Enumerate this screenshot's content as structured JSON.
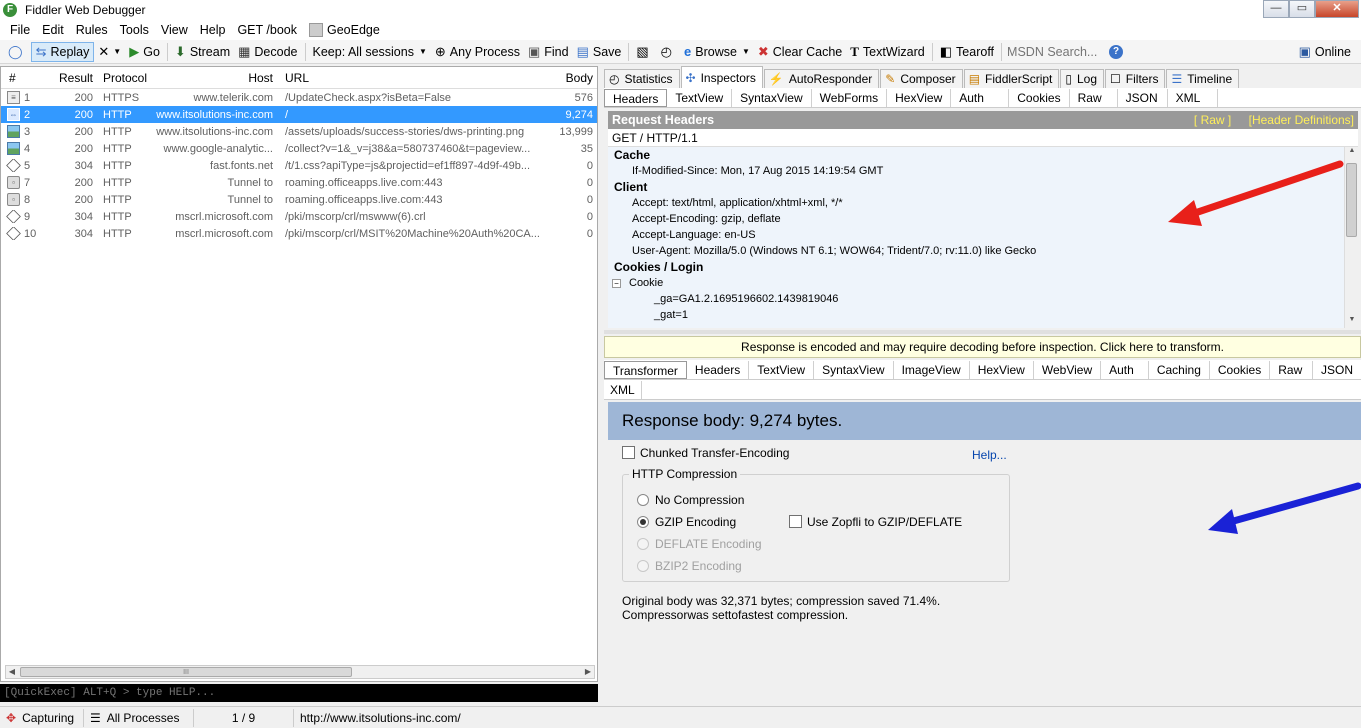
{
  "app": {
    "title": "Fiddler Web Debugger",
    "icon": "fiddler-logo-icon"
  },
  "window_controls": {
    "minimize": "—",
    "maximize": "▭",
    "close": "✕"
  },
  "menu": [
    {
      "label": "File"
    },
    {
      "label": "Edit"
    },
    {
      "label": "Rules"
    },
    {
      "label": "Tools"
    },
    {
      "label": "View"
    },
    {
      "label": "Help"
    },
    {
      "label": "GET /book"
    },
    {
      "label": "GeoEdge"
    }
  ],
  "toolbar": {
    "replay": "Replay",
    "go": "Go",
    "stream": "Stream",
    "decode": "Decode",
    "keep": "Keep: All sessions",
    "any_process": "Any Process",
    "find": "Find",
    "save": "Save",
    "browse": "Browse",
    "clear_cache": "Clear Cache",
    "textwizard": "TextWizard",
    "tearoff": "Tearoff",
    "msdn_placeholder": "MSDN Search...",
    "online": "Online"
  },
  "sessions": {
    "columns": {
      "num": "#",
      "result": "Result",
      "protocol": "Protocol",
      "host": "Host",
      "url": "URL",
      "body": "Body"
    },
    "rows": [
      {
        "num": "1",
        "icon": "document-icon",
        "result": "200",
        "protocol": "HTTPS",
        "host": "www.telerik.com",
        "url": "/UpdateCheck.aspx?isBeta=False",
        "body": "576"
      },
      {
        "num": "2",
        "icon": "arrows-icon",
        "result": "200",
        "protocol": "HTTP",
        "host": "www.itsolutions-inc.com",
        "url": "/",
        "body": "9,274"
      },
      {
        "num": "3",
        "icon": "image-icon",
        "result": "200",
        "protocol": "HTTP",
        "host": "www.itsolutions-inc.com",
        "url": "/assets/uploads/success-stories/dws-printing.png",
        "body": "13,999"
      },
      {
        "num": "4",
        "icon": "image-icon",
        "result": "200",
        "protocol": "HTTP",
        "host": "www.google-analytic...",
        "url": "/collect?v=1&_v=j38&a=580737460&t=pageview...",
        "body": "35"
      },
      {
        "num": "5",
        "icon": "diamond-icon",
        "result": "304",
        "protocol": "HTTP",
        "host": "fast.fonts.net",
        "url": "/t/1.css?apiType=js&projectid=ef1ff897-4d9f-49b...",
        "body": "0"
      },
      {
        "num": "7",
        "icon": "lock-icon",
        "result": "200",
        "protocol": "HTTP",
        "host": "Tunnel to",
        "url": "roaming.officeapps.live.com:443",
        "body": "0"
      },
      {
        "num": "8",
        "icon": "lock-icon",
        "result": "200",
        "protocol": "HTTP",
        "host": "Tunnel to",
        "url": "roaming.officeapps.live.com:443",
        "body": "0"
      },
      {
        "num": "9",
        "icon": "diamond-icon",
        "result": "304",
        "protocol": "HTTP",
        "host": "mscrl.microsoft.com",
        "url": "/pki/mscorp/crl/mswww(6).crl",
        "body": "0"
      },
      {
        "num": "10",
        "icon": "diamond-icon",
        "result": "304",
        "protocol": "HTTP",
        "host": "mscrl.microsoft.com",
        "url": "/pki/mscorp/crl/MSIT%20Machine%20Auth%20CA...",
        "body": "0"
      }
    ],
    "selected_index": 1,
    "scroll_grip": "III"
  },
  "quickexec": {
    "placeholder": "[QuickExec] ALT+Q > type HELP..."
  },
  "statusbar": {
    "capturing": "Capturing",
    "processes": "All Processes",
    "count": "1 / 9",
    "url": "http://www.itsolutions-inc.com/"
  },
  "main_tabs": [
    {
      "label": "Statistics",
      "icon": "stopwatch-icon"
    },
    {
      "label": "Inspectors",
      "icon": "inspector-icon"
    },
    {
      "label": "AutoResponder",
      "icon": "lightning-icon"
    },
    {
      "label": "Composer",
      "icon": "composer-icon"
    },
    {
      "label": "FiddlerScript",
      "icon": "script-icon"
    },
    {
      "label": "Log",
      "icon": "log-icon"
    },
    {
      "label": "Filters",
      "icon": "checkbox-icon"
    },
    {
      "label": "Timeline",
      "icon": "timeline-icon"
    }
  ],
  "request_tabs": [
    "Headers",
    "TextView",
    "SyntaxView",
    "WebForms",
    "HexView",
    "Auth",
    "Cookies",
    "Raw",
    "JSON",
    "XML"
  ],
  "request_headers": {
    "title": "Request Headers",
    "raw_link": "[ Raw ]",
    "defs_link": "[Header Definitions]",
    "request_line": "GET / HTTP/1.1",
    "groups": [
      {
        "name": "Cache",
        "lines": [
          "If-Modified-Since: Mon, 17 Aug 2015 14:19:54 GMT"
        ]
      },
      {
        "name": "Client",
        "lines": [
          "Accept: text/html, application/xhtml+xml, */*",
          "Accept-Encoding: gzip, deflate",
          "Accept-Language: en-US",
          "User-Agent: Mozilla/5.0 (Windows NT 6.1; WOW64; Trident/7.0; rv:11.0) like Gecko"
        ]
      },
      {
        "name": "Cookies / Login",
        "cookie_label": "Cookie",
        "lines": [
          "_ga=GA1.2.1695196602.1439819046",
          "_gat=1"
        ]
      }
    ]
  },
  "response": {
    "encoded_notice": "Response is encoded and may require decoding before inspection. Click here to transform.",
    "tabs_row1": [
      "Transformer",
      "Headers",
      "TextView",
      "SyntaxView",
      "ImageView",
      "HexView",
      "WebView",
      "Auth",
      "Caching",
      "Cookies",
      "Raw",
      "JSON"
    ],
    "tabs_row2": [
      "XML"
    ],
    "body_banner": "Response body: 9,274 bytes.",
    "chunked_label": "Chunked Transfer-Encoding",
    "help_link": "Help...",
    "compression_group": "HTTP Compression",
    "options": [
      {
        "label": "No Compression",
        "selected": false,
        "enabled": true
      },
      {
        "label": "GZIP Encoding",
        "selected": true,
        "enabled": true
      },
      {
        "label": "DEFLATE Encoding",
        "selected": false,
        "enabled": false
      },
      {
        "label": "BZIP2 Encoding",
        "selected": false,
        "enabled": false
      }
    ],
    "zopfli_label": "Use Zopfli to GZIP/DEFLATE",
    "summary_line1": "Original body was 32,371 bytes; compression saved 71.4%.",
    "summary_line2": "Compressorwas settofastest compression."
  },
  "colors": {
    "selected_row": "#3399ff",
    "banner": "#9eb6d6",
    "red_arrow": "#e8201a",
    "blue_arrow": "#1a22d6"
  }
}
